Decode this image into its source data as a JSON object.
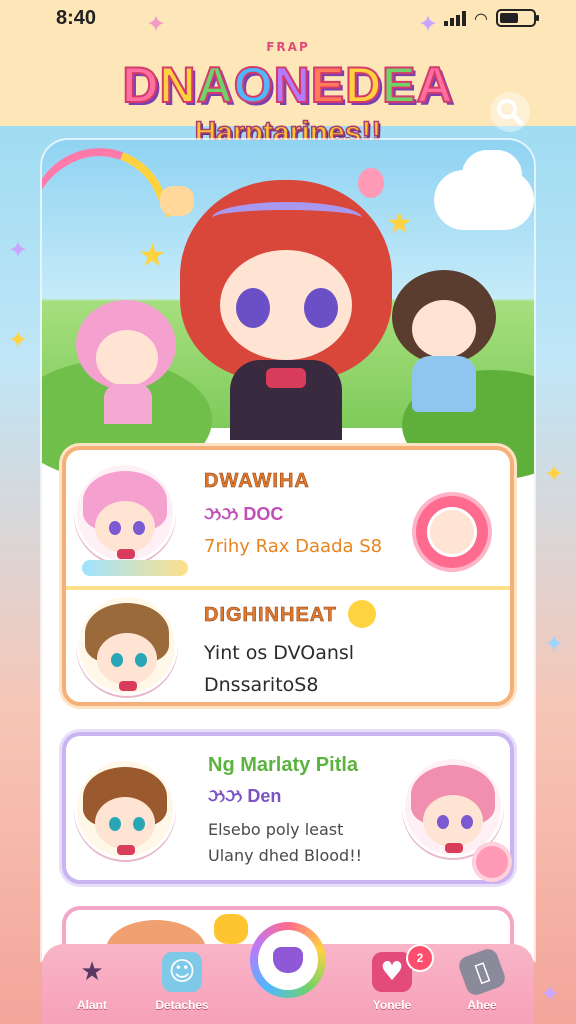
{
  "status_bar": {
    "time": "8:40"
  },
  "header": {
    "small_text": "FRAP",
    "title_letters": [
      "D",
      "N",
      "A",
      "O",
      "N",
      "E",
      "D",
      "E",
      "A"
    ],
    "subtitle": "Harptarines!!",
    "search_icon": "search-icon"
  },
  "items": [
    {
      "title": "DWAWIHA",
      "tag": "ઝઝ DOC",
      "desc": "7rihy Rax Daada S8",
      "action_icon": "ring-avatar-icon"
    },
    {
      "title": "DIGHINHEAT",
      "line1": "Yint os DVOansl",
      "line2": "DnssaritoS8"
    },
    {
      "title": "Ng Marlaty Pitla",
      "tag": "ઝઝ Den",
      "line1": "Elsebo poly least",
      "line2": "Ulany dhed Blood!!"
    }
  ],
  "tabs": [
    {
      "label": "Alant",
      "icon": "star-icon"
    },
    {
      "label": "Detaches",
      "icon": "robot-icon"
    },
    {
      "label": "",
      "icon": "heart-icon"
    },
    {
      "label": "Yonele",
      "icon": "gift-icon",
      "badge": "2"
    },
    {
      "label": "Ahee",
      "icon": "phone-icon"
    }
  ],
  "colors": {
    "accent": "#ff6b8f",
    "card_border_orange": "#f5b07a",
    "card_border_purple": "#c9b3f0"
  }
}
